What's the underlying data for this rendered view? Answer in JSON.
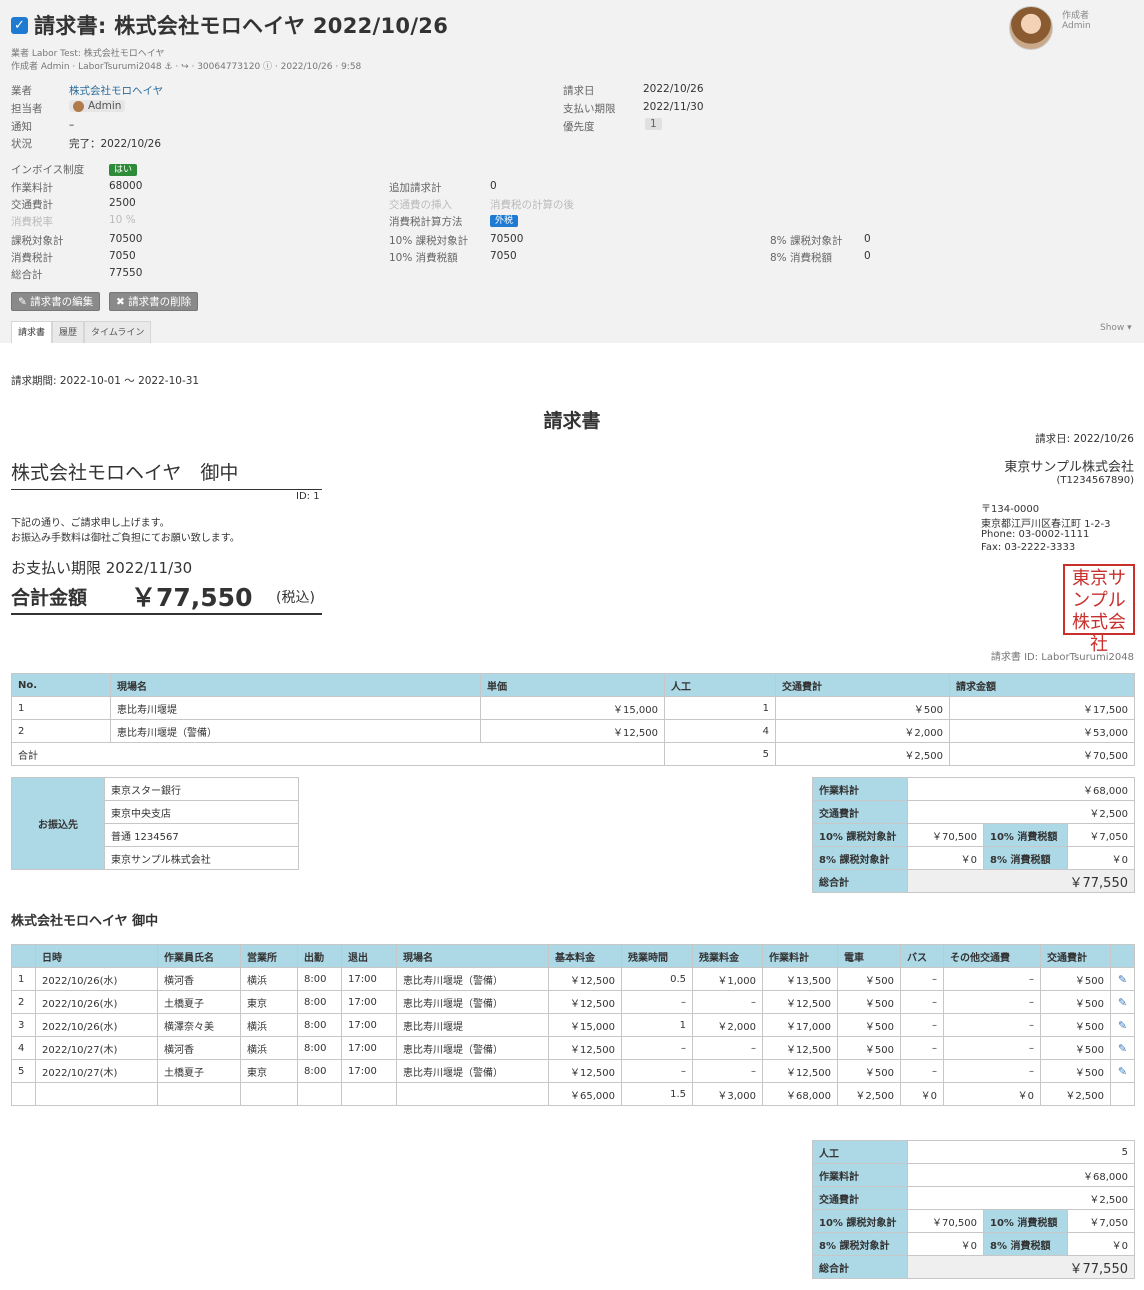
{
  "header": {
    "title": "請求書: 株式会社モロヘイヤ 2022/10/26",
    "sub1": "業者 Labor Test: 株式会社モロヘイヤ",
    "sub2": "作成者 Admin · LaborTsurumi2048 ⚓ · ↪ · 30064773120 ⓘ · 2022/10/26 · 9:58",
    "creator_label": "作成者",
    "creator_name": "Admin"
  },
  "fields_left": [
    {
      "label": "業者",
      "value": "株式会社モロヘイヤ"
    },
    {
      "label": "担当者",
      "value": "Admin"
    },
    {
      "label": "通知",
      "value": "–"
    },
    {
      "label": "状況",
      "value": "完了：2022/10/26"
    }
  ],
  "fields_right": [
    {
      "label": "請求日",
      "value": "2022/10/26"
    },
    {
      "label": "支払い期限",
      "value": "2022/11/30"
    },
    {
      "label": "優先度",
      "value": "1"
    }
  ],
  "finance": {
    "invoice_system": {
      "label": "インボイス制度",
      "value": "はい"
    },
    "labor_total": {
      "label": "作業料計",
      "value": "68000"
    },
    "transport_total": {
      "label": "交通費計",
      "value": "2500"
    },
    "tax_rate": {
      "label": "消費税率",
      "value": "10 %"
    },
    "taxable_total": {
      "label": "課税対象計",
      "value": "70500"
    },
    "tax_total": {
      "label": "消費税計",
      "value": "7050"
    },
    "grand_total": {
      "label": "総合計",
      "value": "77550"
    },
    "extra_total": {
      "label": "追加請求計",
      "value": "0"
    },
    "transport_insert": {
      "label": "交通費の挿入",
      "value": "消費税の計算の後"
    },
    "tax_method": {
      "label": "消費税計算方法",
      "value": "外税"
    },
    "taxable10": {
      "label": "10% 課税対象計",
      "value": "70500"
    },
    "tax10": {
      "label": "10% 消費税額",
      "value": "7050"
    },
    "taxable8": {
      "label": "8% 課税対象計",
      "value": "0"
    },
    "tax8": {
      "label": "8% 消費税額",
      "value": "0"
    }
  },
  "buttons": {
    "edit": "✎ 請求書の編集",
    "delete": "✖ 請求書の削除"
  },
  "tabs": [
    "請求書",
    "履歴",
    "タイムライン"
  ],
  "show_label": "Show ▾",
  "invoice": {
    "period": "請求期間: 2022-10-01 〜 2022-10-31",
    "title": "請求書",
    "issue_date": "請求日: 2022/10/26",
    "client": "株式会社モロヘイヤ　御中",
    "client_id": "ID: 1",
    "message1": "下記の通り、ご請求申し上げます。",
    "message2": "お振込み手数料は御社ご負担にてお願い致します。",
    "due": "お支払い期限 2022/11/30",
    "total_label": "合計金額",
    "total_value": "￥77,550",
    "total_tax": "(税込)",
    "company": "東京サンプル株式会社",
    "company_no": "(T1234567890)",
    "postal": "〒134-0000",
    "address": "東京都江戸川区春江町 1-2-3",
    "phone": "Phone: 03-0002-1111",
    "fax": "Fax: 03-2222-3333",
    "seal": "東京サンプル株式会社",
    "invoice_id": "請求書 ID: LaborTsurumi2048"
  },
  "summary_table": {
    "headers": [
      "No.",
      "現場名",
      "単価",
      "人工",
      "交通費計",
      "請求金額"
    ],
    "rows": [
      [
        "1",
        "恵比寿川堰堤",
        "￥15,000",
        "1",
        "￥500",
        "￥17,500"
      ],
      [
        "2",
        "恵比寿川堰堤（警備）",
        "￥12,500",
        "4",
        "￥2,000",
        "￥53,000"
      ]
    ],
    "total_row": [
      "合計",
      "5",
      "￥2,500",
      "￥70,500"
    ]
  },
  "bank": {
    "label": "お振込先",
    "lines": [
      "東京スター銀行",
      "東京中央支店",
      "普通 1234567",
      "東京サンプル株式会社"
    ]
  },
  "totals1": {
    "labor": [
      "作業料計",
      "￥68,000"
    ],
    "transport": [
      "交通費計",
      "￥2,500"
    ],
    "taxable10": [
      "10% 課税対象計",
      "￥70,500"
    ],
    "tax10": [
      "10% 消費税額",
      "￥7,050"
    ],
    "taxable8": [
      "8% 課税対象計",
      "￥0"
    ],
    "tax8": [
      "8% 消費税額",
      "￥0"
    ],
    "grand": [
      "総合計",
      "￥77,550"
    ]
  },
  "detail_title": "株式会社モロヘイヤ 御中",
  "detail_table": {
    "headers": [
      "",
      "日時",
      "作業員氏名",
      "営業所",
      "出勤",
      "退出",
      "現場名",
      "基本料金",
      "残業時間",
      "残業料金",
      "作業料計",
      "電車",
      "バス",
      "その他交通費",
      "交通費計",
      ""
    ],
    "rows": [
      [
        "1",
        "2022/10/26(水)",
        "横河香",
        "横浜",
        "8:00",
        "17:00",
        "恵比寿川堰堤（警備）",
        "￥12,500",
        "0.5",
        "￥1,000",
        "￥13,500",
        "￥500",
        "–",
        "–",
        "￥500"
      ],
      [
        "2",
        "2022/10/26(水)",
        "土橋夏子",
        "東京",
        "8:00",
        "17:00",
        "恵比寿川堰堤（警備）",
        "￥12,500",
        "–",
        "–",
        "￥12,500",
        "￥500",
        "–",
        "–",
        "￥500"
      ],
      [
        "3",
        "2022/10/26(水)",
        "横澤奈々美",
        "横浜",
        "8:00",
        "17:00",
        "恵比寿川堰堤",
        "￥15,000",
        "1",
        "￥2,000",
        "￥17,000",
        "￥500",
        "–",
        "–",
        "￥500"
      ],
      [
        "4",
        "2022/10/27(木)",
        "横河香",
        "横浜",
        "8:00",
        "17:00",
        "恵比寿川堰堤（警備）",
        "￥12,500",
        "–",
        "–",
        "￥12,500",
        "￥500",
        "–",
        "–",
        "￥500"
      ],
      [
        "5",
        "2022/10/27(木)",
        "土橋夏子",
        "東京",
        "8:00",
        "17:00",
        "恵比寿川堰堤（警備）",
        "￥12,500",
        "–",
        "–",
        "￥12,500",
        "￥500",
        "–",
        "–",
        "￥500"
      ]
    ],
    "total_row": [
      "￥65,000",
      "1.5",
      "￥3,000",
      "￥68,000",
      "￥2,500",
      "￥0",
      "￥0",
      "￥2,500"
    ]
  },
  "totals2": {
    "workers": [
      "人工",
      "5"
    ],
    "labor": [
      "作業料計",
      "￥68,000"
    ],
    "transport": [
      "交通費計",
      "￥2,500"
    ],
    "taxable10": [
      "10% 課税対象計",
      "￥70,500"
    ],
    "tax10": [
      "10% 消費税額",
      "￥7,050"
    ],
    "taxable8": [
      "8% 課税対象計",
      "￥0"
    ],
    "tax8": [
      "8% 消費税額",
      "￥0"
    ],
    "grand": [
      "総合計",
      "￥77,550"
    ]
  }
}
